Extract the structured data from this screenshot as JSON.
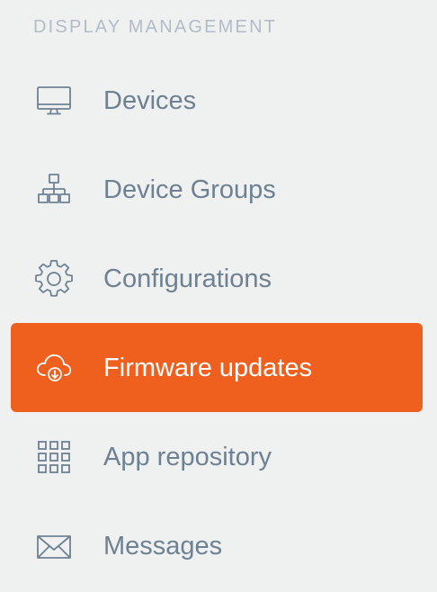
{
  "sidebar": {
    "section_title": "DISPLAY MANAGEMENT",
    "accent_color": "#ef5f1d",
    "text_color": "#6e8193",
    "items": [
      {
        "label": "Devices",
        "icon": "monitor-icon",
        "active": false
      },
      {
        "label": "Device Groups",
        "icon": "hierarchy-icon",
        "active": false
      },
      {
        "label": "Configurations",
        "icon": "gear-icon",
        "active": false
      },
      {
        "label": "Firmware updates",
        "icon": "cloud-download-icon",
        "active": true
      },
      {
        "label": "App repository",
        "icon": "grid-icon",
        "active": false
      },
      {
        "label": "Messages",
        "icon": "envelope-icon",
        "active": false
      }
    ]
  }
}
